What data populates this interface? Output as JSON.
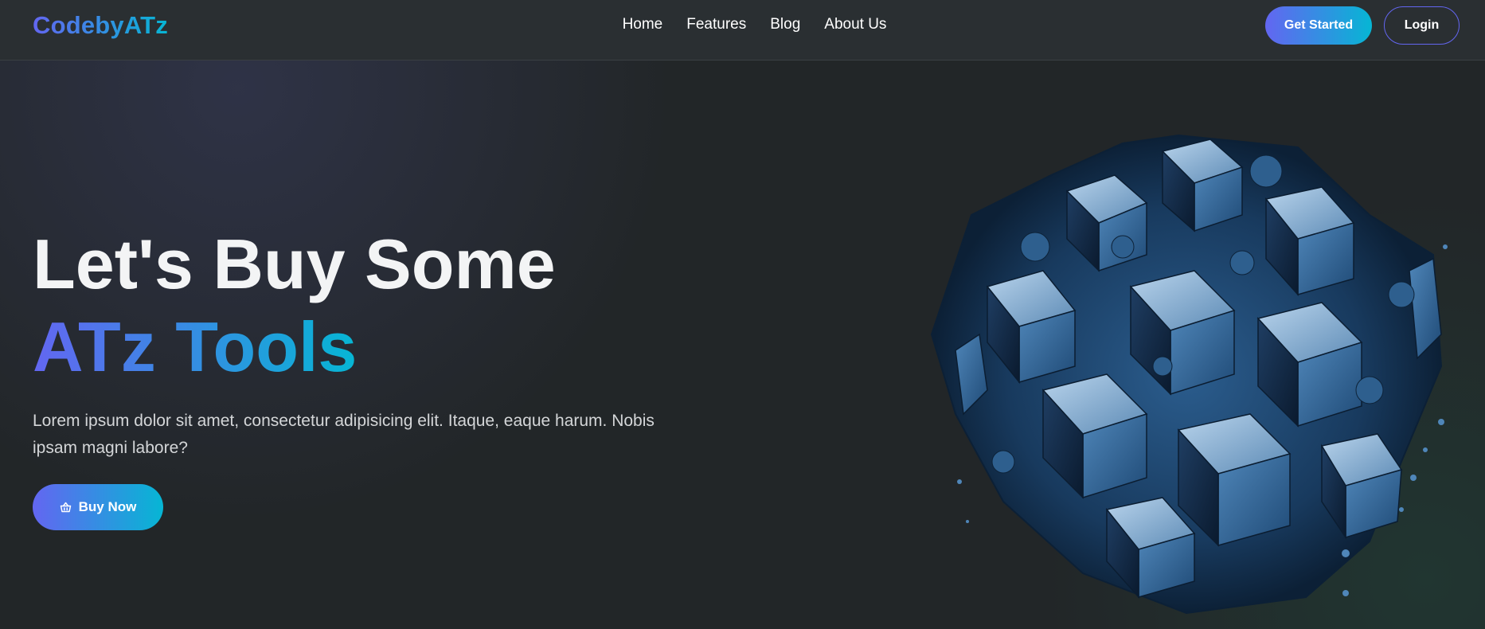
{
  "brand": {
    "logo_text": "CodebyATz"
  },
  "nav": {
    "items": [
      {
        "label": "Home"
      },
      {
        "label": "Features"
      },
      {
        "label": "Blog"
      },
      {
        "label": "About Us"
      }
    ],
    "get_started_label": "Get Started",
    "login_label": "Login"
  },
  "hero": {
    "title_line1": "Let's Buy Some",
    "title_line2": "ATz Tools",
    "description": "Lorem ipsum dolor sit amet, consectetur adipisicing elit. Itaque, eaque harum. Nobis ipsam magni labore?",
    "buy_label": "Buy Now",
    "buy_icon": "basket-icon",
    "image": "abstract-cube-sphere-illustration"
  },
  "colors": {
    "accent_start": "#6366f1",
    "accent_end": "#06b6d4",
    "background": "#222628",
    "navbar": "#2a2f32"
  }
}
